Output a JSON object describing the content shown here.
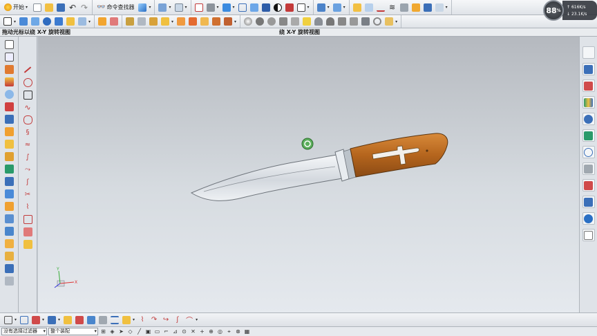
{
  "toolbar1": {
    "start_label": "开始",
    "command_finder_label": "命令查找器",
    "dropdown_glyph": "▾"
  },
  "status": {
    "left": "拖动光标以绕 X-Y 旋转视图",
    "center": "绕 X-Y 旋转视图"
  },
  "bottom": {
    "filter_combo": "没有选择过滤器",
    "assembly_combo": "整个装配"
  },
  "overlay": {
    "cpu_percent": "88",
    "cpu_unit": "%",
    "upload": "616K/s",
    "download": "23.1K/s",
    "up_arrow": "↑",
    "down_arrow": "↓"
  },
  "colors": {
    "handle": "#b5651d",
    "blade": "#e4e8ec",
    "accent": "#2f7bd4"
  }
}
